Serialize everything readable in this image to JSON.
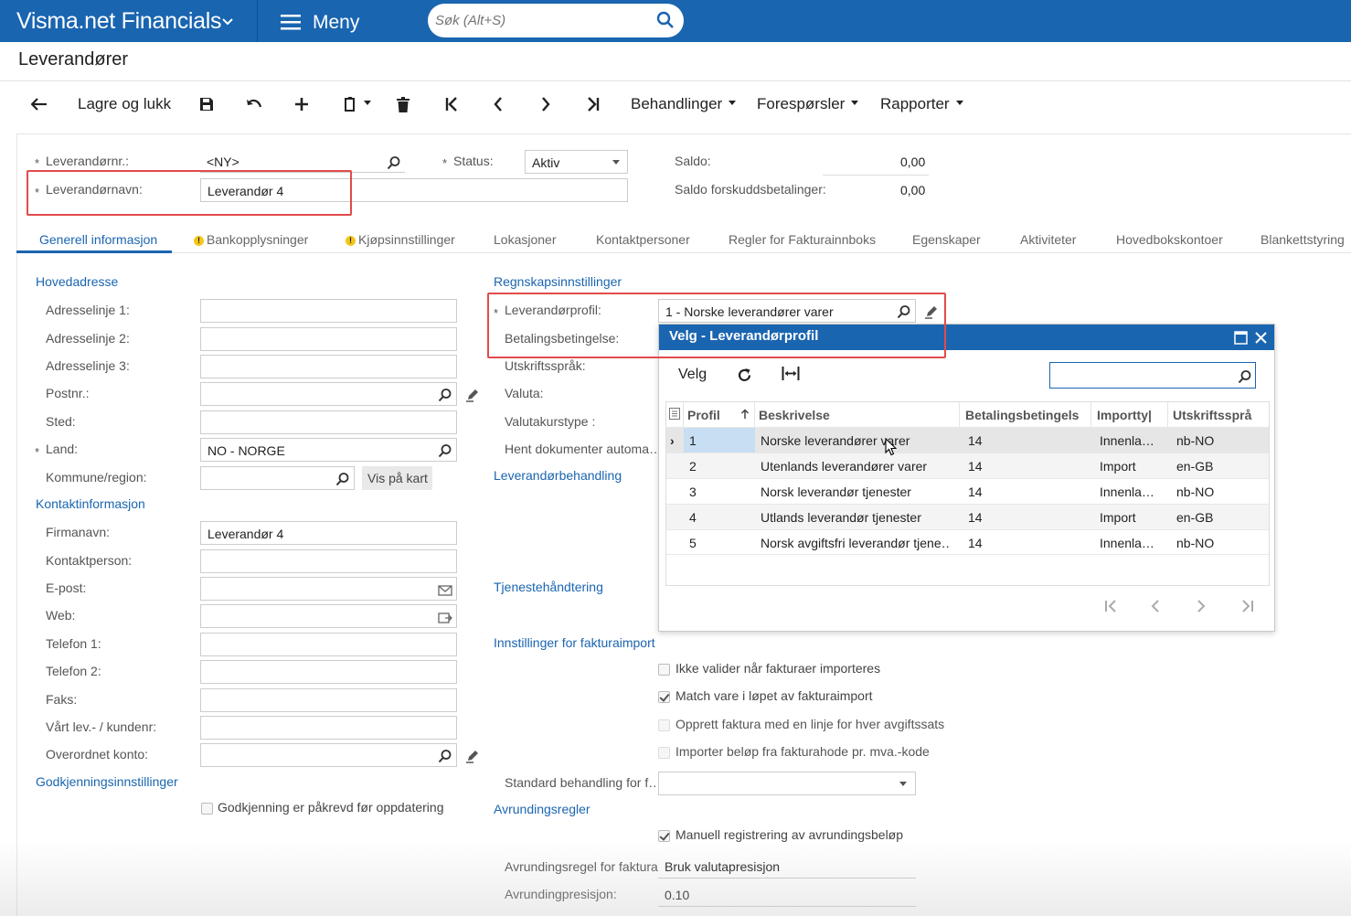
{
  "topbar": {
    "app_name": "Visma.net Financials",
    "menu_label": "Meny",
    "search_placeholder": "Søk (Alt+S)"
  },
  "page": {
    "title": "Leverandører"
  },
  "toolbar": {
    "save_close": "Lagre og lukk",
    "actions": "Behandlinger",
    "inquiries": "Forespørsler",
    "reports": "Rapporter"
  },
  "header": {
    "vendor_no_label": "Leverandørnr.:",
    "vendor_no_value": "<NY>",
    "vendor_name_label": "Leverandørnavn:",
    "vendor_name_value": "Leverandør 4",
    "status_label": "Status:",
    "status_value": "Aktiv",
    "balance_label": "Saldo:",
    "balance_value": "0,00",
    "prepay_label": "Saldo forskuddsbetalinger:",
    "prepay_value": "0,00"
  },
  "tabs": [
    {
      "label": "Generell informasjon"
    },
    {
      "label": "Bankopplysninger"
    },
    {
      "label": "Kjøpsinnstillinger"
    },
    {
      "label": "Lokasjoner"
    },
    {
      "label": "Kontaktpersoner"
    },
    {
      "label": "Regler for Fakturainnboks"
    },
    {
      "label": "Egenskaper"
    },
    {
      "label": "Aktiviteter"
    },
    {
      "label": "Hovedbokskontoer"
    },
    {
      "label": "Blankettstyring"
    }
  ],
  "left": {
    "main_address": "Hovedadresse",
    "addr1": "Adresselinje 1:",
    "addr2": "Adresselinje 2:",
    "addr3": "Adresselinje 3:",
    "postal": "Postnr.:",
    "city": "Sted:",
    "country": "Land:",
    "country_value": "NO - NORGE",
    "municipality": "Kommune/region:",
    "map_button": "Vis på kart",
    "contact_info": "Kontaktinformasjon",
    "company": "Firmanavn:",
    "company_value": "Leverandør 4",
    "contact_person": "Kontaktperson:",
    "email": "E-post:",
    "web": "Web:",
    "phone1": "Telefon 1:",
    "phone2": "Telefon 2:",
    "fax": "Faks:",
    "our_no": "Vårt lev.- / kundenr:",
    "parent_account": "Overordnet konto:",
    "approval_settings": "Godkjenningsinnstillinger",
    "approval_required": "Godkjenning er påkrevd før oppdatering"
  },
  "right": {
    "accounting": "Regnskapsinnstillinger",
    "vendor_profile": "Leverandørprofil:",
    "vendor_profile_value": "1 - Norske leverandører varer",
    "payment_terms": "Betalingsbetingelse:",
    "print_language": "Utskriftsspråk:",
    "currency": "Valuta:",
    "rate_type": "Valutakurstype :",
    "fetch_docs": "Hent dokumenter automa…",
    "vendor_handling": "Leverandørbehandling",
    "service_handling": "Tjenestehåndtering",
    "invoice_import": "Innstillinger for fakturaimport",
    "cb1": "Ikke valider når fakturaer importeres",
    "cb2": "Match vare i løpet av fakturaimport",
    "cb3": "Opprett faktura med en linje for hver avgiftssats",
    "cb4": "Importer beløp fra fakturahode pr. mva.-kode",
    "standard_handling": "Standard behandling for f…",
    "rounding_rules": "Avrundingsregler",
    "manual_rounding": "Manuell registrering av avrundingsbeløp",
    "rounding_rule_label": "Avrundingsregel for faktura:",
    "rounding_rule_value": "Bruk valutapresisjon",
    "rounding_precision_label": "Avrundingpresisjon:",
    "rounding_precision_value": "0.10"
  },
  "popup": {
    "title": "Velg - Leverandørprofil",
    "select_button": "Velg",
    "columns": [
      "Profil",
      "Beskrivelse",
      "Betalingsbetingels",
      "Importty|",
      "Utskriftssprå"
    ],
    "rows": [
      {
        "profile": "1",
        "description": "Norske leverandører varer",
        "terms": "14",
        "import": "Innenla…",
        "lang": "nb-NO"
      },
      {
        "profile": "2",
        "description": "Utenlands leverandører varer",
        "terms": "14",
        "import": "Import",
        "lang": "en-GB"
      },
      {
        "profile": "3",
        "description": "Norsk leverandør tjenester",
        "terms": "14",
        "import": "Innenla…",
        "lang": "nb-NO"
      },
      {
        "profile": "4",
        "description": "Utlands leverandør tjenester",
        "terms": "14",
        "import": "Import",
        "lang": "en-GB"
      },
      {
        "profile": "5",
        "description": "Norsk avgiftsfri leverandør tjene…",
        "terms": "14",
        "import": "Innenla…",
        "lang": "nb-NO"
      }
    ]
  },
  "colors": {
    "brand": "#1a65b0",
    "highlight": "#e24b4b",
    "selected_row": "#c8def3"
  },
  "icons": [
    "chevron-down-icon",
    "hamburger-icon",
    "search-icon",
    "back-arrow-icon",
    "save-icon",
    "undo-icon",
    "plus-icon",
    "copy-paste-icon",
    "trash-icon",
    "first-page-icon",
    "prev-page-icon",
    "next-page-icon",
    "last-page-icon",
    "pencil-icon",
    "envelope-icon",
    "external-link-icon",
    "refresh-icon",
    "fit-columns-icon",
    "maximize-icon",
    "close-icon",
    "sort-up-icon",
    "mouse-cursor-icon"
  ]
}
